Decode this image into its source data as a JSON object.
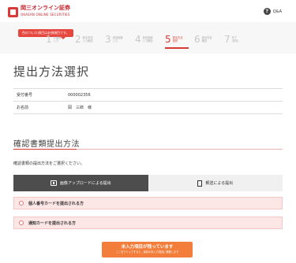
{
  "header": {
    "brand_name": "岡三オンライン証券",
    "brand_sub": "OKASAN ONLINE SECURITIES",
    "qa_label": "Q&A",
    "qa_icon": "question-circle-icon"
  },
  "progress": {
    "tooltip": "色のついた項目は必須項目です。",
    "steps": [
      {
        "num": "1",
        "label": "お客様\n入力"
      },
      {
        "num": "2",
        "label": "基本事項\n入力確認"
      },
      {
        "num": "3",
        "label": "投資経験\n入力"
      },
      {
        "num": "4",
        "label": "投資経験\n入力確認"
      },
      {
        "num": "5",
        "label": "提出方法\n選択"
      },
      {
        "num": "6",
        "label": "提出内容\n確認"
      },
      {
        "num": "7",
        "label": "完了\n(送信)"
      }
    ],
    "active_step": 5
  },
  "main": {
    "title": "提出方法選択",
    "info": [
      {
        "label": "受付番号",
        "value": "000002356"
      },
      {
        "label": "お名前",
        "value": "岡　三郎　様"
      }
    ],
    "section_title": "確認書類提出方法",
    "instruction": "確認書類の提出方法をご選択ください。",
    "tabs": [
      {
        "label": "画像アップロードによる提出",
        "icon": "upload-icon"
      },
      {
        "label": "郵送による提出",
        "icon": "document-icon"
      }
    ],
    "options": [
      {
        "label": "個人番号カードを提出される方"
      },
      {
        "label": "通知カードを提出される方"
      }
    ],
    "cta": {
      "main": "未入力項目が残っています",
      "sub": "ここをクリックすると、最初の未入力項目に移動します"
    }
  },
  "colors": {
    "brand_red": "#c4262e",
    "accent": "#d73a33",
    "cta_orange": "#f37d3b",
    "required_bg": "#fde6e6"
  }
}
